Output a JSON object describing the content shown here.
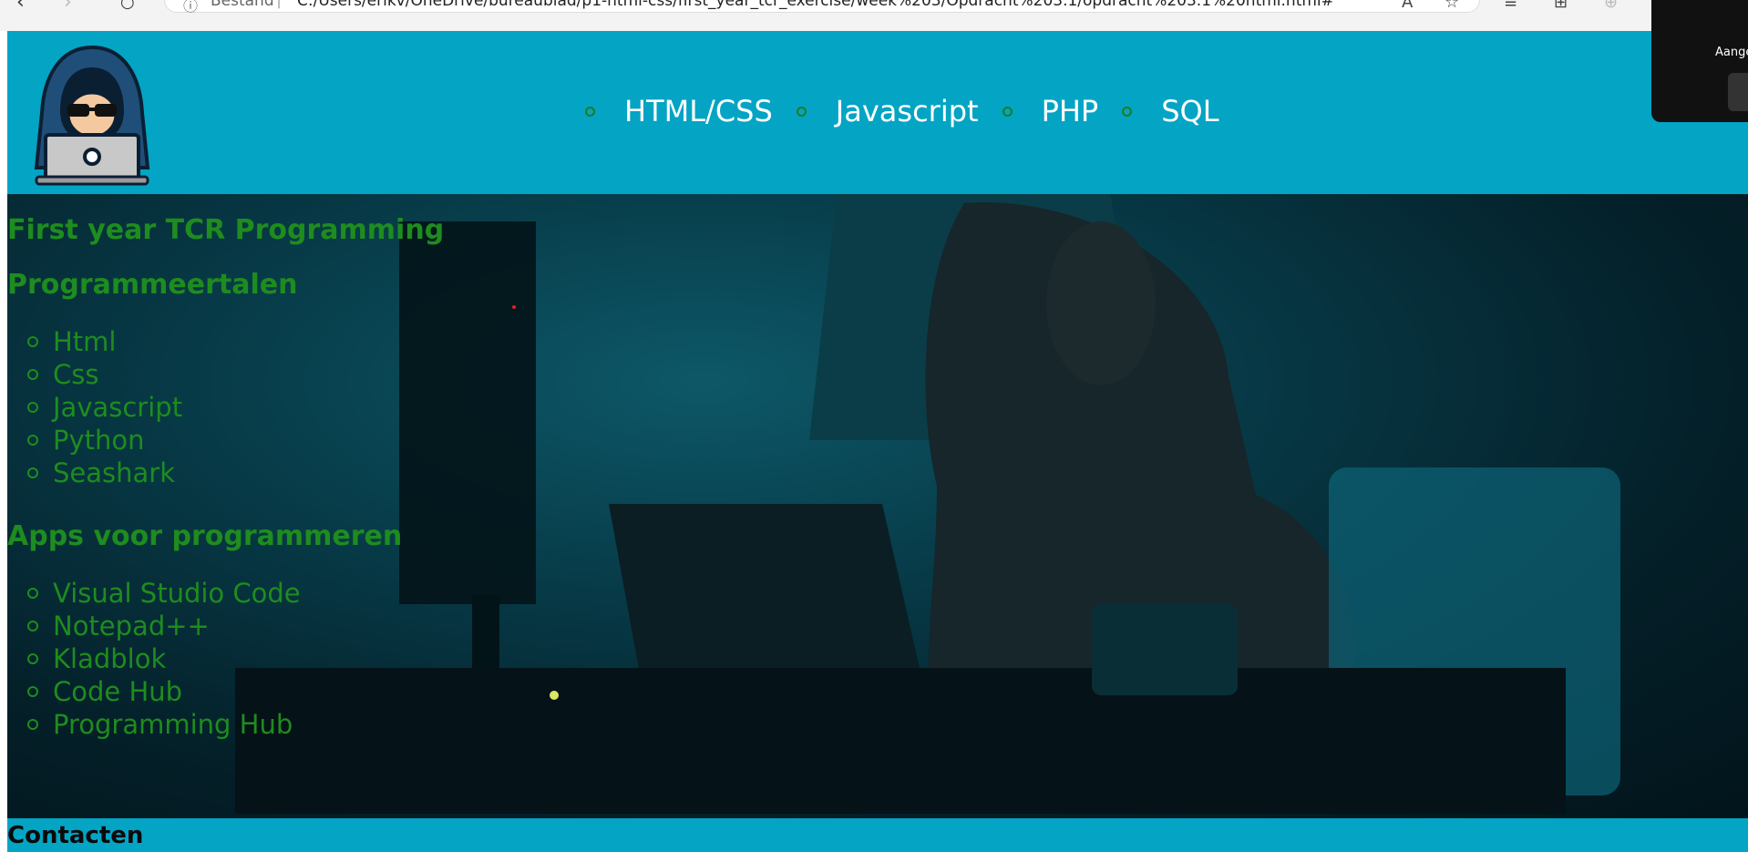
{
  "browser": {
    "back_icon": "back-arrow-icon",
    "forward_icon": "forward-arrow-icon",
    "site_info": "Bestand",
    "url": "C:/Users/erikv/OneDrive/bureaublad/p1-html-css/first_year_tcr_exercise/week%203/Opdracht%203.1/opdracht%203.1%20html.html#"
  },
  "header": {
    "logo_icon": "hacker-laptop-icon",
    "nav": [
      {
        "label": "HTML/CSS"
      },
      {
        "label": "Javascript"
      },
      {
        "label": "PHP"
      },
      {
        "label": "SQL"
      }
    ]
  },
  "main": {
    "title": "First year TCR Programming",
    "languages_heading": "Programmeertalen",
    "languages": [
      "Html",
      "Css",
      "Javascript",
      "Python",
      "Seashark"
    ],
    "apps_heading": "Apps voor programmeren",
    "apps": [
      "Visual Studio Code",
      "Notepad++",
      "Kladblok",
      "Code Hub",
      "Programming Hub"
    ]
  },
  "footer": {
    "heading": "Contacten"
  },
  "notification": {
    "text": "Aange"
  },
  "colors": {
    "header_bg": "#04a4c4",
    "nav_text": "#ffffff",
    "content_text": "#1e8c1e",
    "footer_text": "#0a0a0a"
  }
}
